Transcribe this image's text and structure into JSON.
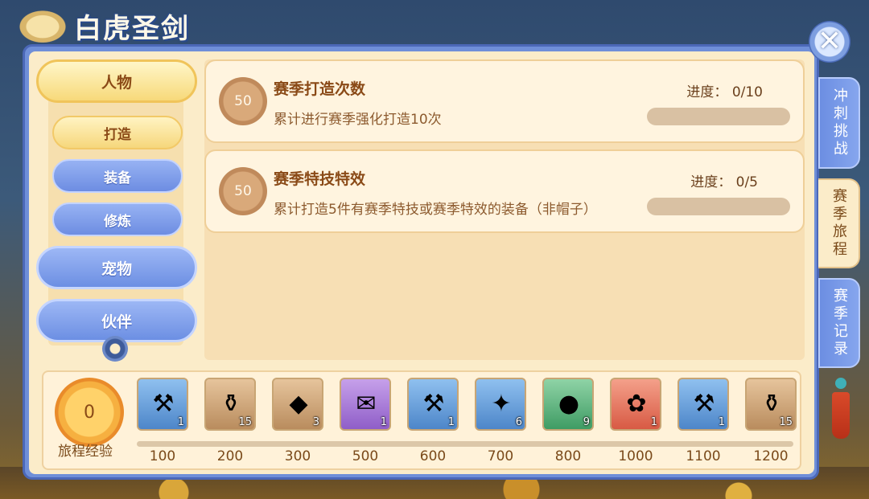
{
  "header": {
    "title": "白虎圣剑"
  },
  "close": {
    "label": "✕"
  },
  "nav": {
    "categories": [
      {
        "label": "人物"
      },
      {
        "label": "宠物"
      },
      {
        "label": "伙伴"
      }
    ],
    "subitems": [
      {
        "label": "打造"
      },
      {
        "label": "装备"
      },
      {
        "label": "修炼"
      }
    ]
  },
  "tasks": [
    {
      "points": "50",
      "title": "赛季打造次数",
      "description": "累计进行赛季强化打造10次",
      "progress_label": "进度：",
      "progress_text": "0/10",
      "progress_fraction": 0
    },
    {
      "points": "50",
      "title": "赛季特技特效",
      "description": "累计打造5件有赛季特技或赛季特效的装备（非帽子）",
      "progress_label": "进度：",
      "progress_text": "0/5",
      "progress_fraction": 0
    }
  ],
  "side_tabs": [
    {
      "label": "冲刺挑战"
    },
    {
      "label": "赛季旅程"
    },
    {
      "label": "赛季记录"
    }
  ],
  "journey": {
    "exp_value": "0",
    "exp_label": "旅程经验",
    "rewards": [
      {
        "icon": "hammer-icon",
        "glyph": "⚒",
        "qty": "1",
        "milestone": "100"
      },
      {
        "icon": "vase-icon",
        "glyph": "⚱",
        "qty": "15",
        "milestone": "200"
      },
      {
        "icon": "crystal-icon",
        "glyph": "◆",
        "qty": "3",
        "milestone": "300"
      },
      {
        "icon": "scroll-icon",
        "glyph": "✉",
        "qty": "1",
        "milestone": "500"
      },
      {
        "icon": "hammer-icon",
        "glyph": "⚒",
        "qty": "1",
        "milestone": "600"
      },
      {
        "icon": "green-gem-icon",
        "glyph": "✦",
        "qty": "6",
        "milestone": "700"
      },
      {
        "icon": "orb-icon",
        "glyph": "●",
        "qty": "9",
        "milestone": "800"
      },
      {
        "icon": "talisman-icon",
        "glyph": "✿",
        "qty": "1",
        "milestone": "1000"
      },
      {
        "icon": "hammer-icon",
        "glyph": "⚒",
        "qty": "1",
        "milestone": "1100"
      },
      {
        "icon": "vase-icon",
        "glyph": "⚱",
        "qty": "15",
        "milestone": "1200"
      }
    ]
  }
}
